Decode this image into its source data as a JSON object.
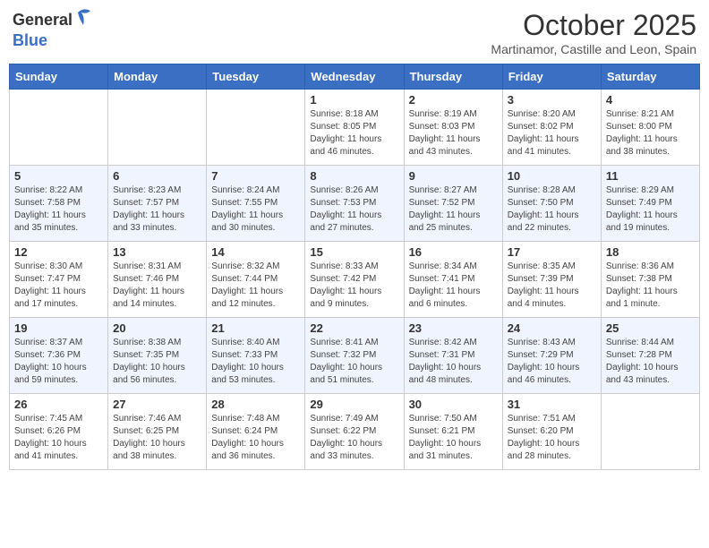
{
  "header": {
    "logo_general": "General",
    "logo_blue": "Blue",
    "month": "October 2025",
    "location": "Martinamor, Castille and Leon, Spain"
  },
  "days_of_week": [
    "Sunday",
    "Monday",
    "Tuesday",
    "Wednesday",
    "Thursday",
    "Friday",
    "Saturday"
  ],
  "weeks": [
    [
      {
        "day": "",
        "info": ""
      },
      {
        "day": "",
        "info": ""
      },
      {
        "day": "",
        "info": ""
      },
      {
        "day": "1",
        "info": "Sunrise: 8:18 AM\nSunset: 8:05 PM\nDaylight: 11 hours\nand 46 minutes."
      },
      {
        "day": "2",
        "info": "Sunrise: 8:19 AM\nSunset: 8:03 PM\nDaylight: 11 hours\nand 43 minutes."
      },
      {
        "day": "3",
        "info": "Sunrise: 8:20 AM\nSunset: 8:02 PM\nDaylight: 11 hours\nand 41 minutes."
      },
      {
        "day": "4",
        "info": "Sunrise: 8:21 AM\nSunset: 8:00 PM\nDaylight: 11 hours\nand 38 minutes."
      }
    ],
    [
      {
        "day": "5",
        "info": "Sunrise: 8:22 AM\nSunset: 7:58 PM\nDaylight: 11 hours\nand 35 minutes."
      },
      {
        "day": "6",
        "info": "Sunrise: 8:23 AM\nSunset: 7:57 PM\nDaylight: 11 hours\nand 33 minutes."
      },
      {
        "day": "7",
        "info": "Sunrise: 8:24 AM\nSunset: 7:55 PM\nDaylight: 11 hours\nand 30 minutes."
      },
      {
        "day": "8",
        "info": "Sunrise: 8:26 AM\nSunset: 7:53 PM\nDaylight: 11 hours\nand 27 minutes."
      },
      {
        "day": "9",
        "info": "Sunrise: 8:27 AM\nSunset: 7:52 PM\nDaylight: 11 hours\nand 25 minutes."
      },
      {
        "day": "10",
        "info": "Sunrise: 8:28 AM\nSunset: 7:50 PM\nDaylight: 11 hours\nand 22 minutes."
      },
      {
        "day": "11",
        "info": "Sunrise: 8:29 AM\nSunset: 7:49 PM\nDaylight: 11 hours\nand 19 minutes."
      }
    ],
    [
      {
        "day": "12",
        "info": "Sunrise: 8:30 AM\nSunset: 7:47 PM\nDaylight: 11 hours\nand 17 minutes."
      },
      {
        "day": "13",
        "info": "Sunrise: 8:31 AM\nSunset: 7:46 PM\nDaylight: 11 hours\nand 14 minutes."
      },
      {
        "day": "14",
        "info": "Sunrise: 8:32 AM\nSunset: 7:44 PM\nDaylight: 11 hours\nand 12 minutes."
      },
      {
        "day": "15",
        "info": "Sunrise: 8:33 AM\nSunset: 7:42 PM\nDaylight: 11 hours\nand 9 minutes."
      },
      {
        "day": "16",
        "info": "Sunrise: 8:34 AM\nSunset: 7:41 PM\nDaylight: 11 hours\nand 6 minutes."
      },
      {
        "day": "17",
        "info": "Sunrise: 8:35 AM\nSunset: 7:39 PM\nDaylight: 11 hours\nand 4 minutes."
      },
      {
        "day": "18",
        "info": "Sunrise: 8:36 AM\nSunset: 7:38 PM\nDaylight: 11 hours\nand 1 minute."
      }
    ],
    [
      {
        "day": "19",
        "info": "Sunrise: 8:37 AM\nSunset: 7:36 PM\nDaylight: 10 hours\nand 59 minutes."
      },
      {
        "day": "20",
        "info": "Sunrise: 8:38 AM\nSunset: 7:35 PM\nDaylight: 10 hours\nand 56 minutes."
      },
      {
        "day": "21",
        "info": "Sunrise: 8:40 AM\nSunset: 7:33 PM\nDaylight: 10 hours\nand 53 minutes."
      },
      {
        "day": "22",
        "info": "Sunrise: 8:41 AM\nSunset: 7:32 PM\nDaylight: 10 hours\nand 51 minutes."
      },
      {
        "day": "23",
        "info": "Sunrise: 8:42 AM\nSunset: 7:31 PM\nDaylight: 10 hours\nand 48 minutes."
      },
      {
        "day": "24",
        "info": "Sunrise: 8:43 AM\nSunset: 7:29 PM\nDaylight: 10 hours\nand 46 minutes."
      },
      {
        "day": "25",
        "info": "Sunrise: 8:44 AM\nSunset: 7:28 PM\nDaylight: 10 hours\nand 43 minutes."
      }
    ],
    [
      {
        "day": "26",
        "info": "Sunrise: 7:45 AM\nSunset: 6:26 PM\nDaylight: 10 hours\nand 41 minutes."
      },
      {
        "day": "27",
        "info": "Sunrise: 7:46 AM\nSunset: 6:25 PM\nDaylight: 10 hours\nand 38 minutes."
      },
      {
        "day": "28",
        "info": "Sunrise: 7:48 AM\nSunset: 6:24 PM\nDaylight: 10 hours\nand 36 minutes."
      },
      {
        "day": "29",
        "info": "Sunrise: 7:49 AM\nSunset: 6:22 PM\nDaylight: 10 hours\nand 33 minutes."
      },
      {
        "day": "30",
        "info": "Sunrise: 7:50 AM\nSunset: 6:21 PM\nDaylight: 10 hours\nand 31 minutes."
      },
      {
        "day": "31",
        "info": "Sunrise: 7:51 AM\nSunset: 6:20 PM\nDaylight: 10 hours\nand 28 minutes."
      },
      {
        "day": "",
        "info": ""
      }
    ]
  ]
}
